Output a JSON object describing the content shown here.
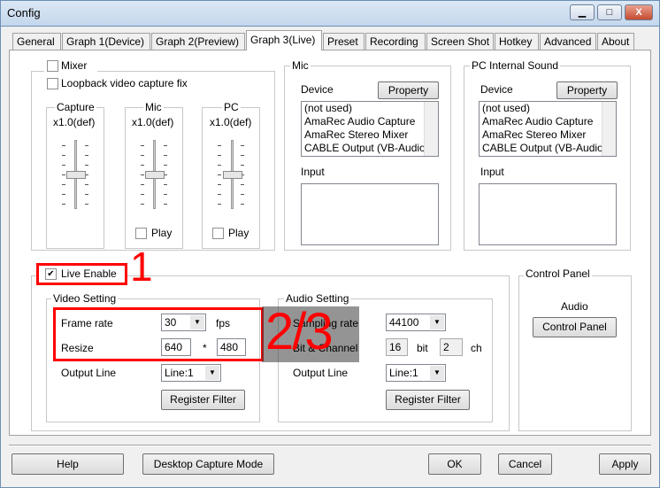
{
  "window": {
    "title": "Config",
    "minimize": "▁",
    "maximize": "□",
    "close": "X"
  },
  "tabs": [
    "General",
    "Graph 1(Device)",
    "Graph 2(Preview)",
    "Graph 3(Live)",
    "Preset",
    "Recording",
    "Screen Shot",
    "Hotkey",
    "Advanced",
    "About"
  ],
  "active_tab": "Graph 3(Live)",
  "mixer": {
    "mixer_label": "Mixer",
    "mixer_checked": false,
    "loopback_label": "Loopback video capture fix",
    "loopback_checked": false,
    "sliders": [
      {
        "label": "Capture",
        "gain": "x1.0(def)"
      },
      {
        "label": "Mic",
        "gain": "x1.0(def)",
        "play": "Play"
      },
      {
        "label": "PC",
        "gain": "x1.0(def)",
        "play": "Play"
      }
    ]
  },
  "mic": {
    "title": "Mic",
    "device_label": "Device",
    "property": "Property",
    "devices": [
      "(not used)",
      "AmaRec Audio Capture",
      "AmaRec Stereo Mixer",
      "CABLE Output (VB-Audio"
    ],
    "input_label": "Input"
  },
  "pc": {
    "title": "PC Internal Sound",
    "device_label": "Device",
    "property": "Property",
    "devices": [
      "(not used)",
      "AmaRec Audio Capture",
      "AmaRec Stereo Mixer",
      "CABLE Output (VB-Audio"
    ],
    "input_label": "Input"
  },
  "live": {
    "enable_label": "Live Enable",
    "enabled": true,
    "annotation1": "1",
    "annotation23": "2/3",
    "video": {
      "title": "Video Setting",
      "frame_rate_label": "Frame rate",
      "frame_rate": "30",
      "fps": "fps",
      "resize_label": "Resize",
      "width": "640",
      "times": "*",
      "height": "480",
      "output_label": "Output Line",
      "output": "Line:1",
      "register": "Register Filter"
    },
    "audio": {
      "title": "Audio Setting",
      "sampling_label": "Sampling rate",
      "sampling": "44100",
      "bitch_label": "Bit & Channel",
      "bit": "16",
      "bit_unit": "bit",
      "ch": "2",
      "ch_unit": "ch",
      "output_label": "Output Line",
      "output": "Line:1",
      "register": "Register Filter"
    }
  },
  "control_panel": {
    "title": "Control Panel",
    "audio_label": "Audio",
    "button": "Control Panel"
  },
  "footer": {
    "help": "Help",
    "desktop": "Desktop Capture Mode",
    "ok": "OK",
    "cancel": "Cancel",
    "apply": "Apply"
  },
  "colors": {
    "annotation": "#ff0000",
    "overlay": "#404040"
  }
}
